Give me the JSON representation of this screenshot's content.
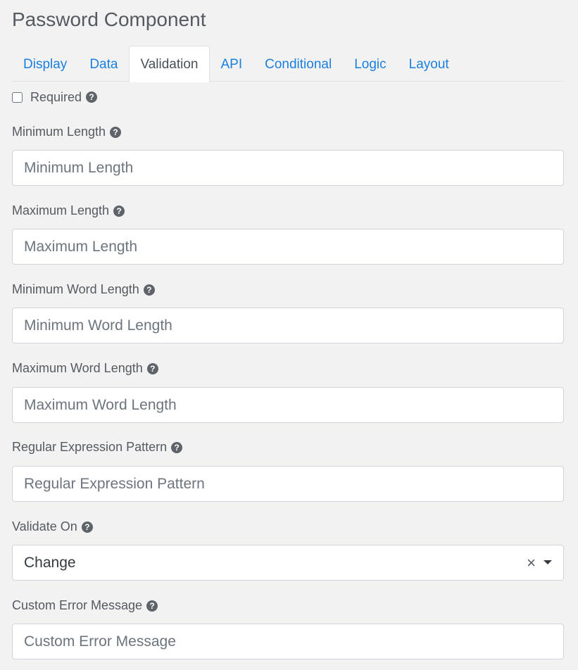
{
  "title": "Password Component",
  "tabs": [
    {
      "label": "Display",
      "active": false
    },
    {
      "label": "Data",
      "active": false
    },
    {
      "label": "Validation",
      "active": true
    },
    {
      "label": "API",
      "active": false
    },
    {
      "label": "Conditional",
      "active": false
    },
    {
      "label": "Logic",
      "active": false
    },
    {
      "label": "Layout",
      "active": false
    }
  ],
  "required": {
    "label": "Required",
    "checked": false
  },
  "fields": {
    "min_length": {
      "label": "Minimum Length",
      "placeholder": "Minimum Length",
      "value": ""
    },
    "max_length": {
      "label": "Maximum Length",
      "placeholder": "Maximum Length",
      "value": ""
    },
    "min_word_length": {
      "label": "Minimum Word Length",
      "placeholder": "Minimum Word Length",
      "value": ""
    },
    "max_word_length": {
      "label": "Maximum Word Length",
      "placeholder": "Maximum Word Length",
      "value": ""
    },
    "regex_pattern": {
      "label": "Regular Expression Pattern",
      "placeholder": "Regular Expression Pattern",
      "value": ""
    },
    "validate_on": {
      "label": "Validate On",
      "value": "Change",
      "clear_symbol": "×"
    },
    "custom_error": {
      "label": "Custom Error Message",
      "placeholder": "Custom Error Message",
      "value": ""
    }
  },
  "help_glyph": "?",
  "icons": {
    "help": "question-circle-icon",
    "clear": "close-icon",
    "caret": "caret-down-icon"
  },
  "colors": {
    "link": "#1a7fde",
    "background": "#f2f2f2",
    "input_border": "#ced4da"
  }
}
